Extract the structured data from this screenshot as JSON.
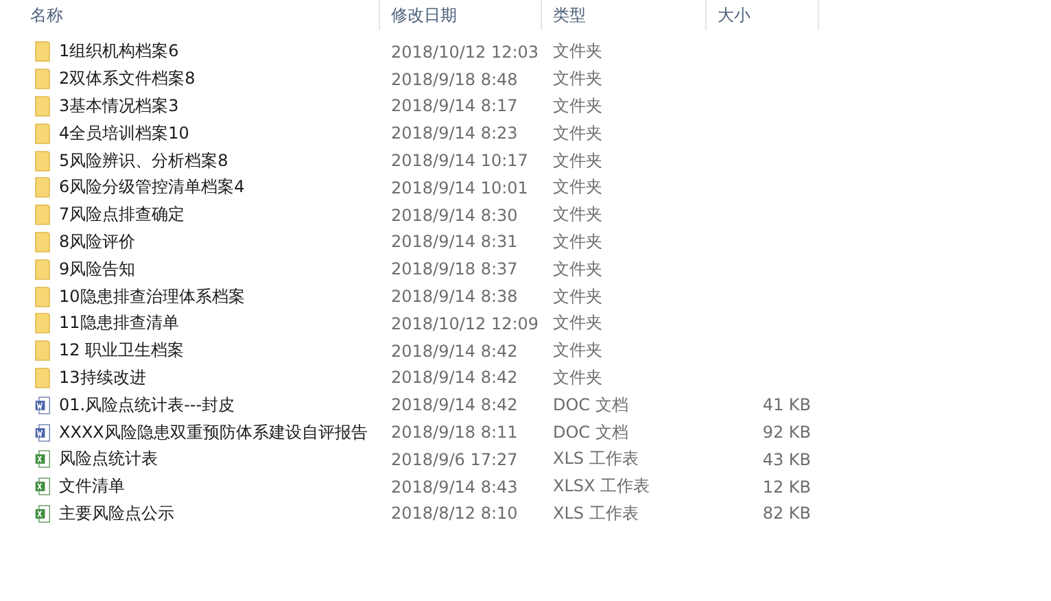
{
  "columns": [
    "名称",
    "修改日期",
    "类型",
    "大小"
  ],
  "files": [
    {
      "kind": "folder",
      "name": "1组织机构档案6",
      "date": "2018/10/12 12:03",
      "type": "文件夹"
    },
    {
      "kind": "folder",
      "name": "2双体系文件档案8",
      "date": "2018/9/18 8:48",
      "type": "文件夹"
    },
    {
      "kind": "folder",
      "name": "3基本情况档案3",
      "date": "2018/9/14 8:17",
      "type": "文件夹"
    },
    {
      "kind": "folder",
      "name": "4全员培训档案10",
      "date": "2018/9/14 8:23",
      "type": "文件夹"
    },
    {
      "kind": "folder",
      "name": "5风险辨识、分析档案8",
      "date": "2018/9/14 10:17",
      "type": "文件夹"
    },
    {
      "kind": "folder",
      "name": "6风险分级管控清单档案4",
      "date": "2018/9/14 10:01",
      "type": "文件夹"
    },
    {
      "kind": "folder",
      "name": "7风险点排查确定",
      "date": "2018/9/14 8:30",
      "type": "文件夹"
    },
    {
      "kind": "folder",
      "name": "8风险评价",
      "date": "2018/9/14 8:31",
      "type": "文件夹"
    },
    {
      "kind": "folder",
      "name": "9风险告知",
      "date": "2018/9/18 8:37",
      "type": "文件夹"
    },
    {
      "kind": "folder",
      "name": "10隐患排查治理体系档案",
      "date": "2018/9/14 8:38",
      "type": "文件夹"
    },
    {
      "kind": "folder",
      "name": "11隐患排查清单",
      "date": "2018/10/12 12:09",
      "type": "文件夹"
    },
    {
      "kind": "folder",
      "name": "12 职业卫生档案",
      "date": "2018/9/14 8:42",
      "type": "文件夹"
    },
    {
      "kind": "folder",
      "name": "13持续改进",
      "date": "2018/9/14 8:42",
      "type": "文件夹"
    },
    {
      "kind": "doc",
      "name": "01.风险点统计表---封皮",
      "date": "2018/9/14 8:42",
      "type": "DOC 文档",
      "size": "41 KB"
    },
    {
      "kind": "doc",
      "name": "XXXX风险隐患双重预防体系建设自评报告",
      "date": "2018/9/18 8:11",
      "type": "DOC 文档",
      "size": "92 KB"
    },
    {
      "kind": "xls",
      "name": "风险点统计表",
      "date": "2018/9/6 17:27",
      "type": "XLS 工作表",
      "size": "43 KB"
    },
    {
      "kind": "xls",
      "name": "文件清单",
      "date": "2018/9/14 8:43",
      "type": "XLSX 工作表",
      "size": "12 KB"
    },
    {
      "kind": "xls",
      "name": "主要风险点公示",
      "date": "2018/8/12 8:10",
      "type": "XLS 工作表",
      "size": "82 KB"
    }
  ]
}
